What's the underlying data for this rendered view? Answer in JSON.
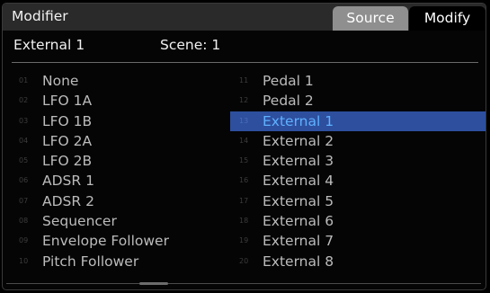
{
  "header": {
    "title": "Modifier",
    "tabs": [
      {
        "label": "Source",
        "active": true
      },
      {
        "label": "Modify",
        "active": false
      }
    ]
  },
  "subheader": {
    "source_name": "External 1",
    "scene": "Scene: 1"
  },
  "list_left": [
    {
      "num": "01",
      "label": "None"
    },
    {
      "num": "02",
      "label": "LFO 1A"
    },
    {
      "num": "03",
      "label": "LFO 1B"
    },
    {
      "num": "04",
      "label": "LFO 2A"
    },
    {
      "num": "05",
      "label": "LFO 2B"
    },
    {
      "num": "06",
      "label": "ADSR 1"
    },
    {
      "num": "07",
      "label": "ADSR 2"
    },
    {
      "num": "08",
      "label": "Sequencer"
    },
    {
      "num": "09",
      "label": "Envelope Follower"
    },
    {
      "num": "10",
      "label": "Pitch Follower"
    }
  ],
  "list_right": [
    {
      "num": "11",
      "label": "Pedal 1"
    },
    {
      "num": "12",
      "label": "Pedal 2"
    },
    {
      "num": "13",
      "label": "External 1",
      "selected": true
    },
    {
      "num": "14",
      "label": "External 2"
    },
    {
      "num": "15",
      "label": "External 3"
    },
    {
      "num": "16",
      "label": "External 4"
    },
    {
      "num": "17",
      "label": "External 5"
    },
    {
      "num": "18",
      "label": "External 6"
    },
    {
      "num": "19",
      "label": "External 7"
    },
    {
      "num": "20",
      "label": "External 8"
    }
  ],
  "colors": {
    "selected_bg": "#2d4f9e",
    "selected_text": "#5fb0ff",
    "active_tab": "#8f8f8f"
  }
}
